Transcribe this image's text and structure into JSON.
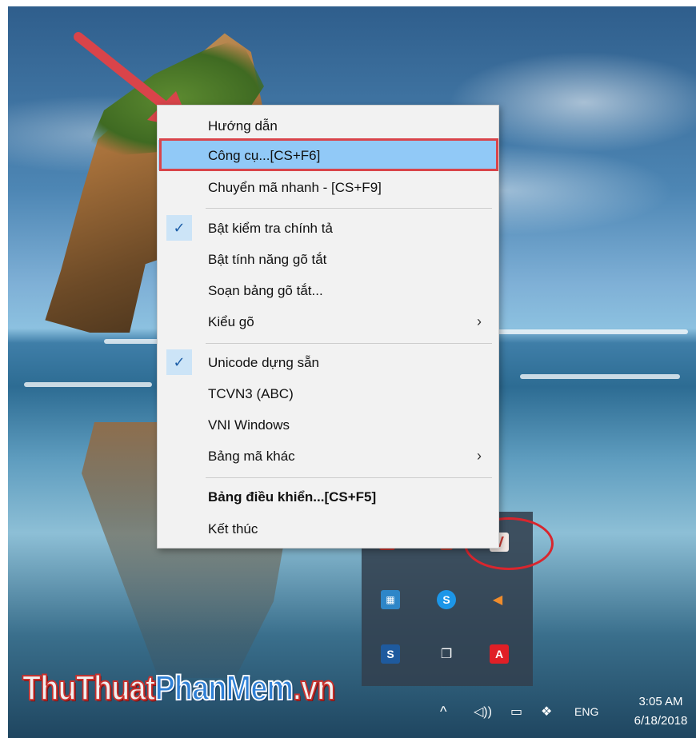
{
  "context_menu": {
    "items": [
      {
        "label": "Hướng dẫn"
      },
      {
        "label": "Công cụ...[CS+F6]",
        "highlighted": true
      },
      {
        "label": "Chuyển mã nhanh - [CS+F9]"
      },
      {
        "label": "Bật kiểm tra chính tả",
        "checked": true
      },
      {
        "label": "Bật tính năng gõ tắt"
      },
      {
        "label": "Soạn bảng gõ tắt..."
      },
      {
        "label": "Kiểu gõ",
        "submenu": true
      },
      {
        "label": "Unicode dựng sẵn",
        "checked": true
      },
      {
        "label": "TCVN3 (ABC)"
      },
      {
        "label": "VNI Windows"
      },
      {
        "label": "Bảng mã khác",
        "submenu": true
      },
      {
        "label": "Bảng điều khiển...[CS+F5]",
        "bold": true
      },
      {
        "label": "Kết thúc"
      }
    ],
    "check_glyph": "✓",
    "submenu_glyph": "›",
    "highlight_color": "#91c9f7",
    "check_bg_color": "#cce4f7"
  },
  "tray_flyout": {
    "icons": [
      "app-icon-partial",
      "mute-app-icon-partial",
      "unikey-v-icon",
      "network-app-icon",
      "skype-icon",
      "speaker-volume-icon",
      "s-app-icon",
      "copy-app-icon",
      "adobe-icon"
    ],
    "unikey_glyph": "V",
    "skype_glyph": "S",
    "s_glyph": "S",
    "adobe_glyph": "A"
  },
  "taskbar": {
    "chevron_glyph": "^",
    "language": "ENG",
    "time": "3:05 AM",
    "date": "6/18/2018"
  },
  "watermark": {
    "part1": "ThuThuat",
    "part2": "PhanMem",
    "part3": ".vn"
  },
  "colors": {
    "annotation_red": "#d9444a",
    "menu_bg": "#f2f2f2"
  }
}
